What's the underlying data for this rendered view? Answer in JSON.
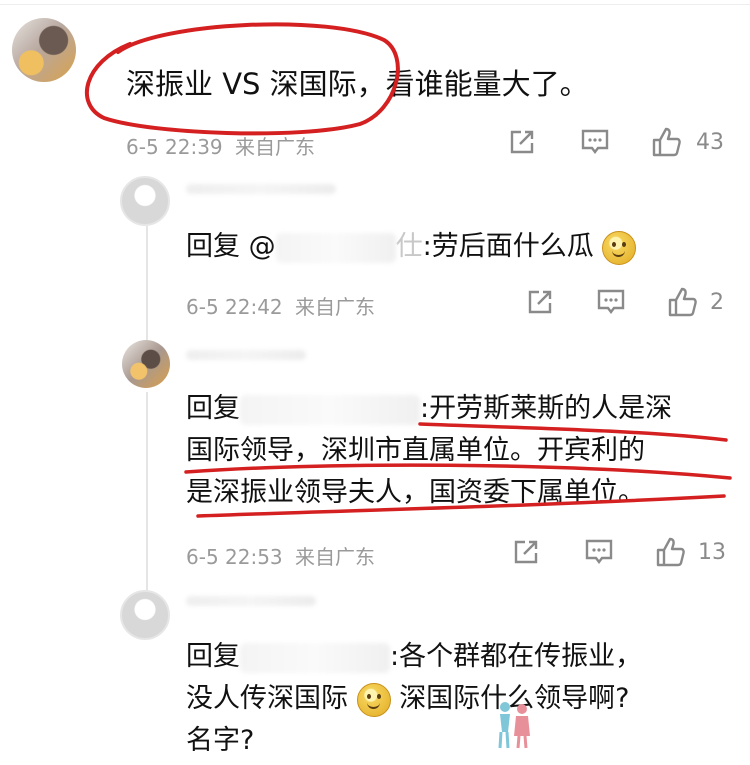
{
  "comments": [
    {
      "text": "深振业 VS 深国际，看谁能量大了。",
      "meta": {
        "time": "6-5 22:39",
        "source": "来自广东"
      },
      "actions": {
        "likes": "43"
      }
    }
  ],
  "replies": [
    {
      "prefix": "回复 @",
      "name_visible": "仕",
      "text": ":劳后面什么瓜",
      "meta": {
        "time": "6-5 22:42",
        "source": "来自广东"
      },
      "actions": {
        "likes": "2"
      }
    },
    {
      "prefix": "回复",
      "text_line1": ":开劳斯莱斯的人是深",
      "text_line2": "国际领导，深圳市直属单位。开宾利的",
      "text_line3": "是深振业领导夫人，国资委下属单位。",
      "meta": {
        "time": "6-5 22:53",
        "source": "来自广东"
      },
      "actions": {
        "likes": "13"
      }
    },
    {
      "prefix": "回复",
      "text_line1": ":各个群都在传振业，",
      "text_line2a": "没人传深国际",
      "text_line2b": "深国际什么领导啊?",
      "text_line3": "名字?"
    }
  ],
  "icons": {
    "share": "share-icon",
    "comment": "comment-icon",
    "like": "thumbs-up-icon",
    "emoji": "grin-emoji-icon"
  },
  "colors": {
    "annotation": "#d42020",
    "meta": "#9a9a9a",
    "text": "#111111"
  }
}
